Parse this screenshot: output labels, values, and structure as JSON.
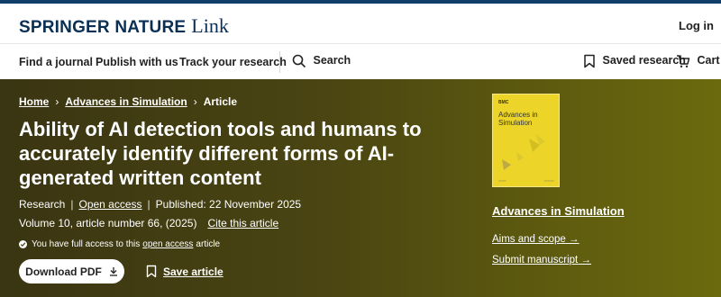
{
  "header": {
    "logo_main": "SPRINGER NATURE",
    "logo_sub": "Link",
    "login": "Log in"
  },
  "nav": {
    "find_journal": "Find a journal",
    "publish": "Publish with us",
    "track": "Track your research",
    "search": "Search",
    "saved": "Saved research",
    "cart": "Cart"
  },
  "breadcrumb": {
    "home": "Home",
    "journal": "Advances in Simulation",
    "current": "Article"
  },
  "article": {
    "title": "Ability of AI detection tools and humans to accurately identify different forms of AI-generated written content",
    "type": "Research",
    "access": "Open access",
    "published": "Published: 22 November 2025",
    "volume": "Volume 10, article number 66, (2025)",
    "cite": "Cite this article",
    "access_note_pre": "You have full access to this",
    "access_note_link": "open access",
    "access_note_post": "article",
    "download": "Download PDF",
    "save": "Save article"
  },
  "journal": {
    "cover_brand": "BMC",
    "cover_title_1": "Advances in",
    "cover_title_2": "Simulation",
    "name": "Advances in Simulation",
    "aims": "Aims and scope",
    "submit": "Submit manuscript"
  },
  "colors": {
    "brand": "#0a2f55",
    "hero_start": "#3a3512",
    "hero_end": "#6b6a0e",
    "cover": "#ecd528"
  }
}
